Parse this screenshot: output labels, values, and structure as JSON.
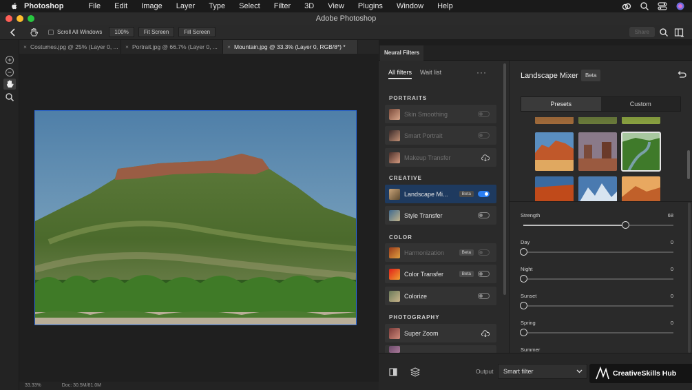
{
  "menubar": {
    "app_name": "Photoshop",
    "items": [
      "File",
      "Edit",
      "Image",
      "Layer",
      "Type",
      "Select",
      "Filter",
      "3D",
      "View",
      "Plugins",
      "Window",
      "Help"
    ]
  },
  "window": {
    "title": "Adobe Photoshop"
  },
  "options_bar": {
    "scroll_all_windows": "Scroll All Windows",
    "zoom_100": "100%",
    "fit_screen": "Fit Screen",
    "fill_screen": "Fill Screen",
    "share": "Share"
  },
  "doc_tabs": [
    {
      "label": "Costumes.jpg @ 25% (Layer 0, ...",
      "active": false
    },
    {
      "label": "Portrait.jpg @ 66.7% (Layer 0, ...",
      "active": false
    },
    {
      "label": "Mountain.jpg @ 33.3% (Layer 0, RGB/8*) *",
      "active": true
    }
  ],
  "status": {
    "zoom": "33.33%",
    "doc": "Doc: 30.5M/81.0M"
  },
  "neural_filters": {
    "panel_title": "Neural Filters",
    "tabs": [
      "All filters",
      "Wait list"
    ],
    "more": "···",
    "categories": {
      "portraits": "PORTRAITS",
      "creative": "CREATIVE",
      "color": "COLOR",
      "photography": "PHOTOGRAPHY"
    },
    "filters": {
      "skin_smoothing": "Skin Smoothing",
      "smart_portrait": "Smart Portrait",
      "makeup_transfer": "Makeup Transfer",
      "landscape_mixer": "Landscape Mi...",
      "style_transfer": "Style Transfer",
      "harmonization": "Harmonization",
      "color_transfer": "Color Transfer",
      "colorize": "Colorize",
      "super_zoom": "Super Zoom"
    },
    "beta": "Beta"
  },
  "settings": {
    "title": "Landscape Mixer",
    "beta": "Beta",
    "seg_presets": "Presets",
    "seg_custom": "Custom",
    "sliders": {
      "strength": {
        "name": "Strength",
        "value": "68",
        "fraction": 0.68
      },
      "day": {
        "name": "Day",
        "value": "0",
        "fraction": 0
      },
      "night": {
        "name": "Night",
        "value": "0",
        "fraction": 0
      },
      "sunset": {
        "name": "Sunset",
        "value": "0",
        "fraction": 0
      },
      "spring": {
        "name": "Spring",
        "value": "0",
        "fraction": 0
      },
      "summer": {
        "name": "Summer"
      }
    }
  },
  "bottom": {
    "output_label": "Output",
    "output_value": "Smart filter"
  },
  "watermark": "CreativeSkills Hub",
  "colors": {
    "accent": "#2b7ff3",
    "selection": "#1e3a5f",
    "canvas_border": "#2c6ad8"
  }
}
